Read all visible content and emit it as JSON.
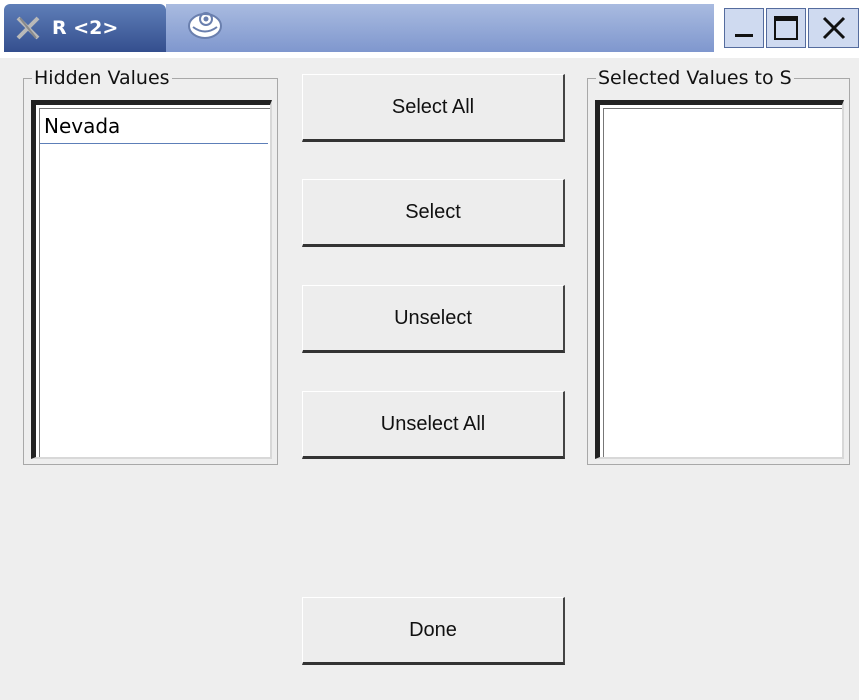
{
  "window": {
    "title": "R <2>"
  },
  "icons": {
    "tab": "x-logo-icon",
    "app": "swirl-app-icon",
    "minimize": "minimize-icon",
    "maximize": "maximize-icon",
    "close": "close-icon"
  },
  "hidden_values": {
    "label": "Hidden Values",
    "items": [
      "Nevada"
    ]
  },
  "selected_values": {
    "label": "Selected Values to S",
    "items": []
  },
  "buttons": {
    "select_all": "Select All",
    "select": "Select",
    "unselect": "Unselect",
    "unselect_all": "Unselect All",
    "done": "Done"
  },
  "colors": {
    "title_tab": "#344f8e",
    "title_strip": "#8fa5d6",
    "window_bg": "#eeeeee",
    "selection_line": "#5d7fb8"
  }
}
